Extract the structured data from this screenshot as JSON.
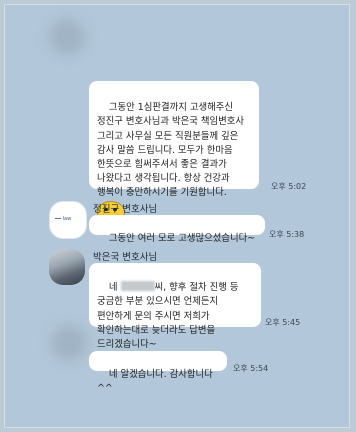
{
  "colors": {
    "background": "#b2c7d9",
    "bubble": "#ffffff",
    "text": "#222222"
  },
  "messages": [
    {
      "sender": "",
      "text": "그동안 1심판결까지 고생해주신 정진구 변호사님과 박은국 책임변호사 그리고 사무실 모든 직원분들께 깊은 감사 말씀 드립니다. 모두가 한마음 한뜻으로 힘써주셔서 좋은 결과가 나왔다고 생각됩니다. 항상 건강과 행복이 충만하시기를 기원합니다.",
      "emoji": "happy-face-icon",
      "time": "오후 5:02"
    },
    {
      "sender": "정진구 변호사님",
      "text": "그동안 여러 모로 고생많으셨습니다~",
      "time": "오후 5:38"
    },
    {
      "sender": "박은국 변호사님",
      "text_prefix": "네",
      "text": "씨, 향후 절차 진행 등 궁금한 부분 있으시면 언제든지 편안하게 문의 주시면 저희가 확인하는대로 늦더라도 답변을 드리겠습니다~",
      "time": "오후 5:45"
    },
    {
      "sender": "",
      "text": "네 알겠습니다. 감사합니다^^",
      "time": "오후 5:54"
    }
  ]
}
